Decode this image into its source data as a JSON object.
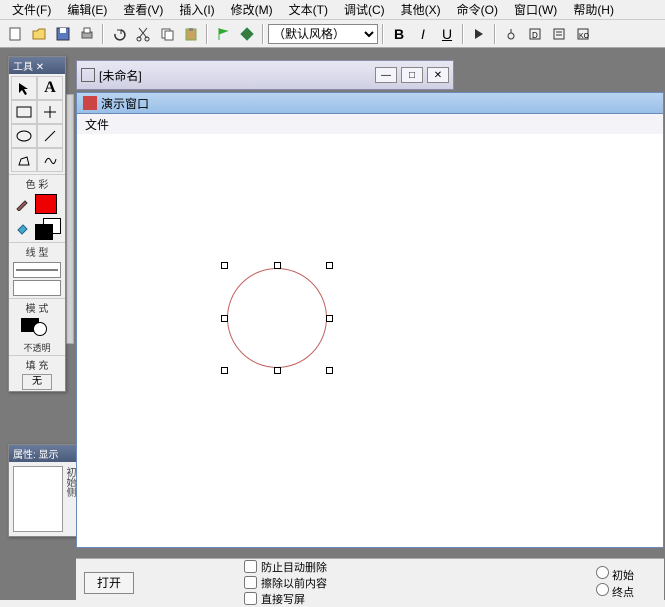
{
  "menu": {
    "file": "文件(F)",
    "edit": "编辑(E)",
    "view": "查看(V)",
    "insert": "插入(I)",
    "modify": "修改(M)",
    "text": "文本(T)",
    "debug": "调试(C)",
    "other": "其他(X)",
    "command": "命令(O)",
    "window": "窗口(W)",
    "help": "帮助(H)"
  },
  "toolbar": {
    "style_label": "（默认风格）"
  },
  "panels": {
    "tools_title": "工具 ✕",
    "color_label": "色 彩",
    "line_label": "线 型",
    "mode_label": "模 式",
    "opacity_label": "不透明",
    "fill_label": "填 充",
    "fill_value": "无",
    "props_title": "属性: 显示",
    "props_side": "初始侧"
  },
  "doc": {
    "untitled": "[未命名]",
    "demo_title": "演示窗口",
    "demo_menu": "文件"
  },
  "bottom": {
    "open": "打开",
    "chk1": "防止目动删除",
    "chk2": "擦除以前内容",
    "chk3": "直接写屏",
    "radio1": "初始",
    "radio2": "终点"
  }
}
